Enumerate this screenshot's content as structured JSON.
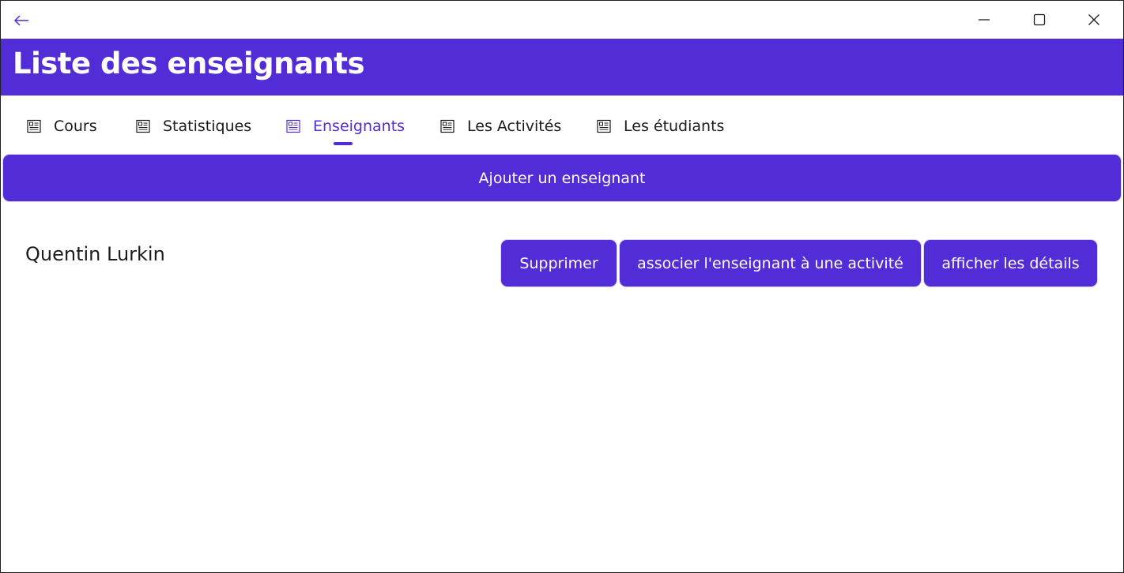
{
  "titlebar": {
    "back_icon": "arrow-left-icon",
    "minimize_icon": "minimize-icon",
    "maximize_icon": "maximize-icon",
    "close_icon": "close-icon"
  },
  "header": {
    "title": "Liste des enseignants"
  },
  "tabs": [
    {
      "label": "Cours",
      "icon": "contact-card-icon",
      "active": false
    },
    {
      "label": "Statistiques",
      "icon": "contact-card-icon",
      "active": false
    },
    {
      "label": "Enseignants",
      "icon": "contact-card-icon",
      "active": true
    },
    {
      "label": "Les Activités",
      "icon": "contact-card-icon",
      "active": false
    },
    {
      "label": "Les étudiants",
      "icon": "contact-card-icon",
      "active": false
    }
  ],
  "add_button": {
    "label": "Ajouter un enseignant"
  },
  "teachers": [
    {
      "name": "Quentin Lurkin",
      "delete_label": "Supprimer",
      "associate_label": "associer l'enseignant à une activité",
      "details_label": "afficher les détails"
    }
  ],
  "colors": {
    "accent": "#522cd6",
    "text": "#1b1b1b",
    "background": "#ffffff"
  }
}
